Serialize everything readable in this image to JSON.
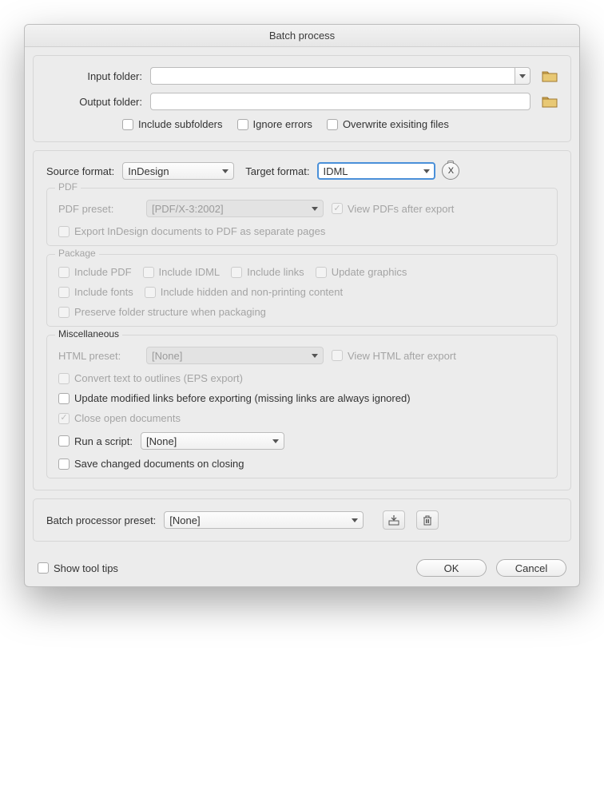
{
  "title": "Batch process",
  "folders": {
    "input_label": "Input folder:",
    "input_value": "",
    "output_label": "Output folder:",
    "output_value": "",
    "include_subfolders": "Include subfolders",
    "ignore_errors": "Ignore errors",
    "overwrite": "Overwrite exisiting files"
  },
  "format": {
    "source_label": "Source format:",
    "source_value": "InDesign",
    "target_label": "Target format:",
    "target_value": "IDML",
    "x_button": "X"
  },
  "pdf": {
    "legend": "PDF",
    "preset_label": "PDF preset:",
    "preset_value": "[PDF/X-3:2002]",
    "view_after": "View PDFs after export",
    "separate_pages": "Export InDesign documents to PDF as separate pages"
  },
  "package": {
    "legend": "Package",
    "include_pdf": "Include PDF",
    "include_idml": "Include IDML",
    "include_links": "Include links",
    "update_graphics": "Update graphics",
    "include_fonts": "Include fonts",
    "include_hidden": "Include hidden and non-printing content",
    "preserve_structure": "Preserve folder structure when packaging"
  },
  "misc": {
    "legend": "Miscellaneous",
    "html_preset_label": "HTML preset:",
    "html_preset_value": "[None]",
    "view_html": "View HTML after export",
    "convert_outlines": "Convert text to outlines (EPS export)",
    "update_links": "Update modified links before exporting (missing links are always ignored)",
    "close_docs": "Close open documents",
    "run_script_label": "Run a script:",
    "run_script_value": "[None]",
    "save_changed": "Save changed documents on closing"
  },
  "preset": {
    "label": "Batch processor preset:",
    "value": "[None]"
  },
  "footer": {
    "tooltips": "Show tool tips",
    "ok": "OK",
    "cancel": "Cancel"
  }
}
